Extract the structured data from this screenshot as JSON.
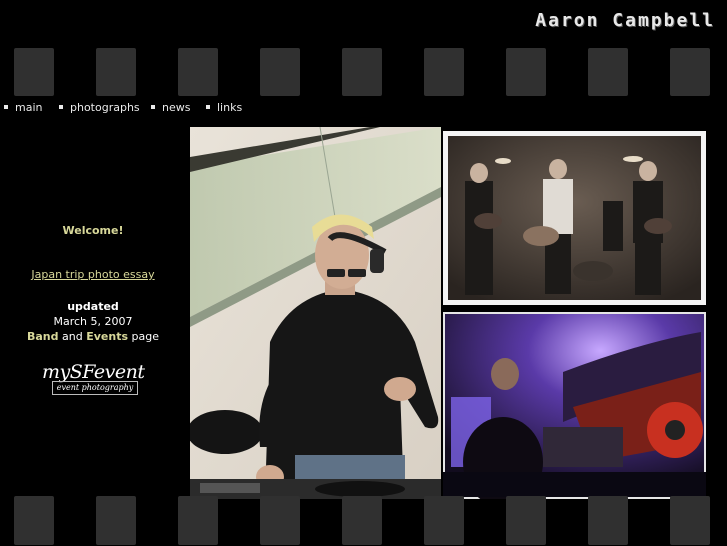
{
  "site": {
    "title": "Aaron Campbell"
  },
  "nav": [
    {
      "label": "main"
    },
    {
      "label": "photographs"
    },
    {
      "label": "news"
    },
    {
      "label": "links"
    }
  ],
  "sidebar": {
    "welcome": "Welcome!",
    "essay_link": "Japan trip photo essay",
    "updated_label": "updated",
    "updated_date": "March 5, 2007",
    "band_word": "Band",
    "and_word": "and",
    "events_word": "Events",
    "page_word": "page"
  },
  "logo": {
    "main": "mySFevent",
    "sub": "event photography"
  },
  "colors": {
    "background": "#000000",
    "filmhole": "#303030",
    "accent_text": "#d8d89a"
  }
}
